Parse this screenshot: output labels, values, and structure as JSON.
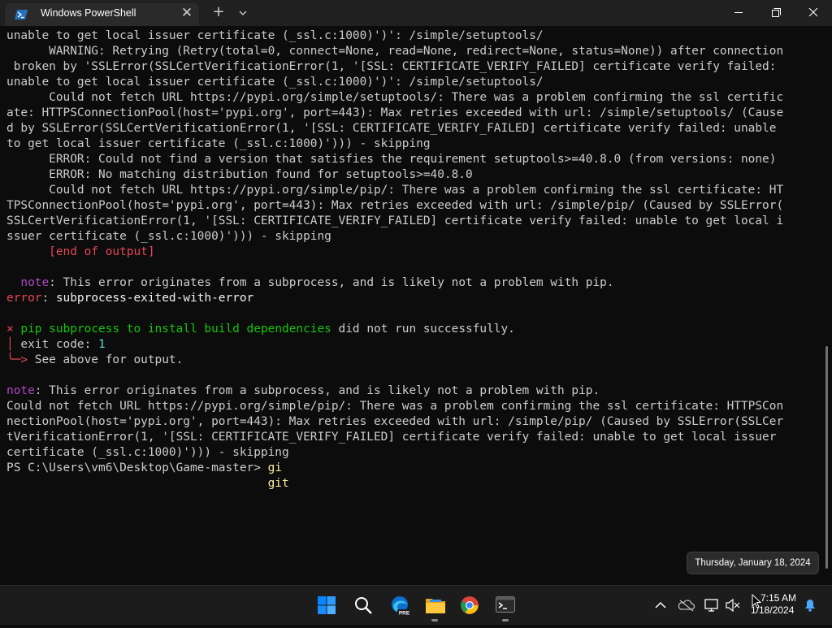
{
  "window": {
    "tab_title": "Windows PowerShell",
    "tab_icon": "powershell-icon",
    "close_tab_icon": "close-icon",
    "new_tab_icon": "plus-icon",
    "dropdown_icon": "chevron-down-icon",
    "minimize_icon": "minimize-icon",
    "maximize_icon": "maximize-icon",
    "close_icon": "close-icon"
  },
  "terminal": {
    "lines": [
      [
        {
          "t": "unable to get local issuer certificate (_ssl.c:1000)')': /simple/setuptools/",
          "c": ""
        }
      ],
      [
        {
          "t": "      WARNING: Retrying (Retry(total=0, connect=None, read=None, redirect=None, status=None)) after connection",
          "c": ""
        }
      ],
      [
        {
          "t": " broken by 'SSLError(SSLCertVerificationError(1, '[SSL: CERTIFICATE_VERIFY_FAILED] certificate verify failed:",
          "c": ""
        }
      ],
      [
        {
          "t": "unable to get local issuer certificate (_ssl.c:1000)')': /simple/setuptools/",
          "c": ""
        }
      ],
      [
        {
          "t": "      Could not fetch URL https://pypi.org/simple/setuptools/: There was a problem confirming the ssl certific",
          "c": ""
        }
      ],
      [
        {
          "t": "ate: HTTPSConnectionPool(host='pypi.org', port=443): Max retries exceeded with url: /simple/setuptools/ (Cause",
          "c": ""
        }
      ],
      [
        {
          "t": "d by SSLError(SSLCertVerificationError(1, '[SSL: CERTIFICATE_VERIFY_FAILED] certificate verify failed: unable",
          "c": ""
        }
      ],
      [
        {
          "t": "to get local issuer certificate (_ssl.c:1000)'))) - skipping",
          "c": ""
        }
      ],
      [
        {
          "t": "      ERROR: Could not find a version that satisfies the requirement setuptools>=40.8.0 (from versions: none)",
          "c": ""
        }
      ],
      [
        {
          "t": "      ERROR: No matching distribution found for setuptools>=40.8.0",
          "c": ""
        }
      ],
      [
        {
          "t": "      Could not fetch URL https://pypi.org/simple/pip/: There was a problem confirming the ssl certificate: HT",
          "c": ""
        }
      ],
      [
        {
          "t": "TPSConnectionPool(host='pypi.org', port=443): Max retries exceeded with url: /simple/pip/ (Caused by SSLError(",
          "c": ""
        }
      ],
      [
        {
          "t": "SSLCertVerificationError(1, '[SSL: CERTIFICATE_VERIFY_FAILED] certificate verify failed: unable to get local i",
          "c": ""
        }
      ],
      [
        {
          "t": "ssuer certificate (_ssl.c:1000)'))) - skipping",
          "c": ""
        }
      ],
      [
        {
          "t": "      ",
          "c": ""
        },
        {
          "t": "[end of output]",
          "c": "red"
        }
      ],
      [
        {
          "t": "",
          "c": ""
        }
      ],
      [
        {
          "t": "  ",
          "c": ""
        },
        {
          "t": "note",
          "c": "mag"
        },
        {
          "t": ": This error originates from a subprocess, and is likely not a problem with pip.",
          "c": ""
        }
      ],
      [
        {
          "t": "error",
          "c": "red"
        },
        {
          "t": ": ",
          "c": ""
        },
        {
          "t": "subprocess-exited-with-error",
          "c": "wht"
        }
      ],
      [
        {
          "t": "",
          "c": ""
        }
      ],
      [
        {
          "t": "×",
          "c": "red"
        },
        {
          "t": " ",
          "c": ""
        },
        {
          "t": "pip subprocess to install build dependencies",
          "c": "grn"
        },
        {
          "t": " did not run successfully.",
          "c": ""
        }
      ],
      [
        {
          "t": "│",
          "c": "red"
        },
        {
          "t": " exit code: ",
          "c": ""
        },
        {
          "t": "1",
          "c": "cyn"
        }
      ],
      [
        {
          "t": "╰─>",
          "c": "red"
        },
        {
          "t": " See above for output.",
          "c": ""
        }
      ],
      [
        {
          "t": "",
          "c": ""
        }
      ],
      [
        {
          "t": "note",
          "c": "mag"
        },
        {
          "t": ": This error originates from a subprocess, and is likely not a problem with pip.",
          "c": ""
        }
      ],
      [
        {
          "t": "Could not fetch URL https://pypi.org/simple/pip/: There was a problem confirming the ssl certificate: HTTPSCon",
          "c": ""
        }
      ],
      [
        {
          "t": "nectionPool(host='pypi.org', port=443): Max retries exceeded with url: /simple/pip/ (Caused by SSLError(SSLCer",
          "c": ""
        }
      ],
      [
        {
          "t": "tVerificationError(1, '[SSL: CERTIFICATE_VERIFY_FAILED] certificate verify failed: unable to get local issuer",
          "c": ""
        }
      ],
      [
        {
          "t": "certificate (_ssl.c:1000)'))) - skipping",
          "c": ""
        }
      ],
      [
        {
          "t": "PS C:\\Users\\vm6\\Desktop\\Game-master> ",
          "c": ""
        },
        {
          "t": "gi",
          "c": "ylw"
        }
      ],
      [
        {
          "t": "                                     ",
          "c": ""
        },
        {
          "t": "git",
          "c": "ylw"
        }
      ]
    ]
  },
  "tooltip": {
    "text": "Thursday, January 18, 2024"
  },
  "taskbar": {
    "apps": [
      {
        "name": "start-icon"
      },
      {
        "name": "search-icon"
      },
      {
        "name": "edge-dev-icon",
        "badge": "PRE"
      },
      {
        "name": "file-explorer-icon"
      },
      {
        "name": "chrome-icon"
      },
      {
        "name": "terminal-icon"
      }
    ],
    "tray": {
      "chevron_icon": "chevron-up-icon",
      "onedrive_icon": "cloud-offline-icon",
      "network_icon": "network-icon",
      "volume_icon": "speaker-muted-icon",
      "notification_icon": "bell-icon"
    },
    "time": "7:15 AM",
    "date": "1/18/2024"
  },
  "colors": {
    "terminal_bg": "#0c0c0c",
    "titlebar_bg": "#202020",
    "taskbar_bg": "#1c1c1c",
    "error_red": "#e74856",
    "note_magenta": "#b148c6",
    "success_green": "#16c60c",
    "value_cyan": "#61d6d6",
    "command_yellow": "#f9f1a5"
  }
}
